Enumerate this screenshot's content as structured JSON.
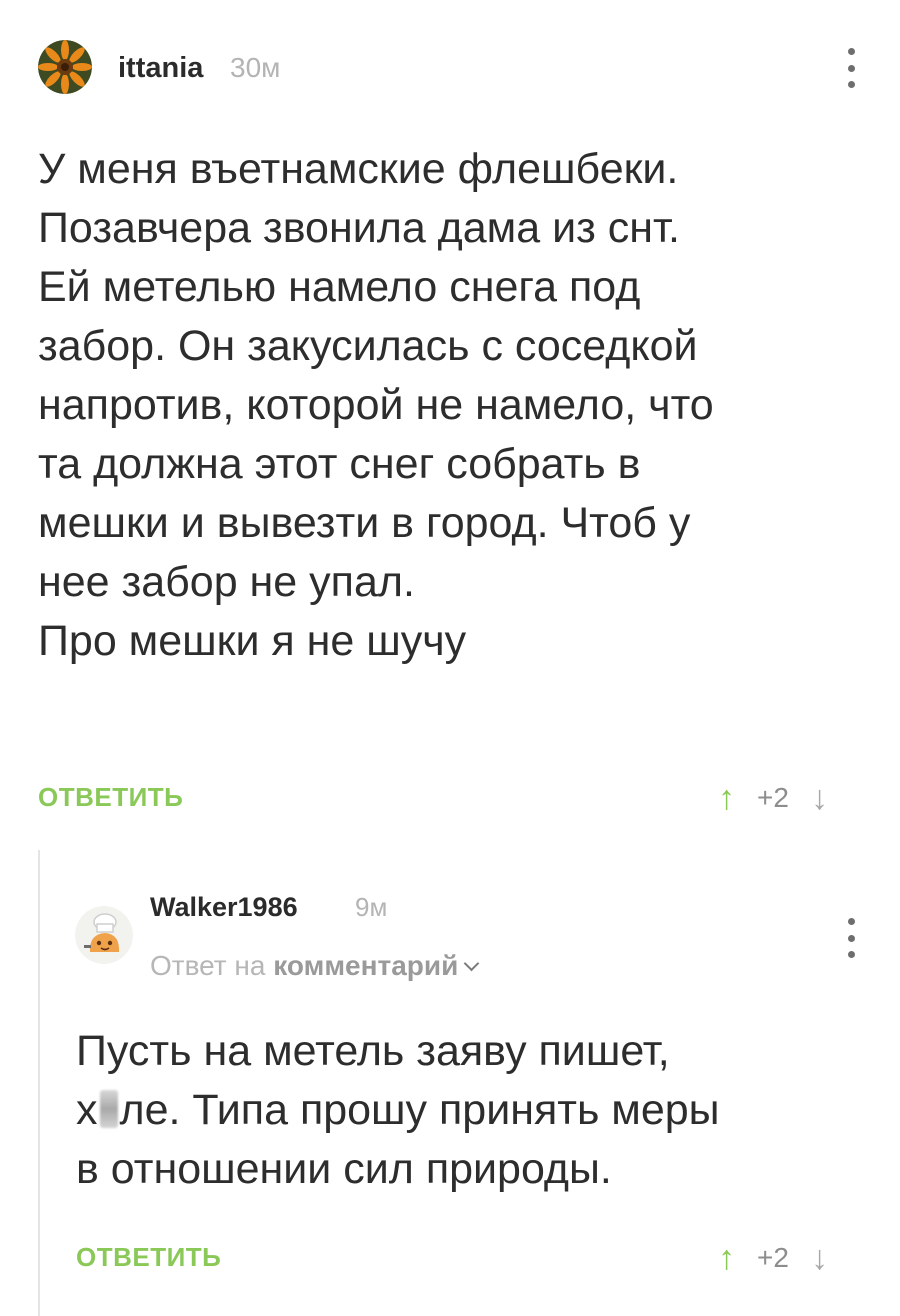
{
  "colors": {
    "accent_green": "#8ac858",
    "text": "#2d2d2d",
    "meta_gray": "#b4b4b4"
  },
  "comments": [
    {
      "author": "ittania",
      "time": "30м",
      "avatar_icon": "orange-flower-avatar",
      "lines": [
        "У меня въетнамские флешбеки.",
        "Позавчера звонила дама из снт.",
        "Ей метелью намело снега под",
        "забор. Он закусилась с соседкой",
        "напротив, которой не намело, что",
        "та должна этот снег собрать в",
        "мешки и вывезти в город. Чтоб у",
        "нее забор не упал.",
        "Про мешки я не шучу"
      ],
      "reply_label": "ОТВЕТИТЬ",
      "score": "+2"
    },
    {
      "author": "Walker1986",
      "time": "9м",
      "avatar_icon": "cartoon-chef-avatar",
      "reply_to_prefix": "Ответ на",
      "reply_to_link": "комментарий",
      "lines": [
        "Пусть на метель заяву пишет,",
        "х",
        "ле. Типа прошу принять меры",
        "в отношении сил природы."
      ],
      "reply_label": "ОТВЕТИТЬ",
      "score": "+2"
    }
  ]
}
